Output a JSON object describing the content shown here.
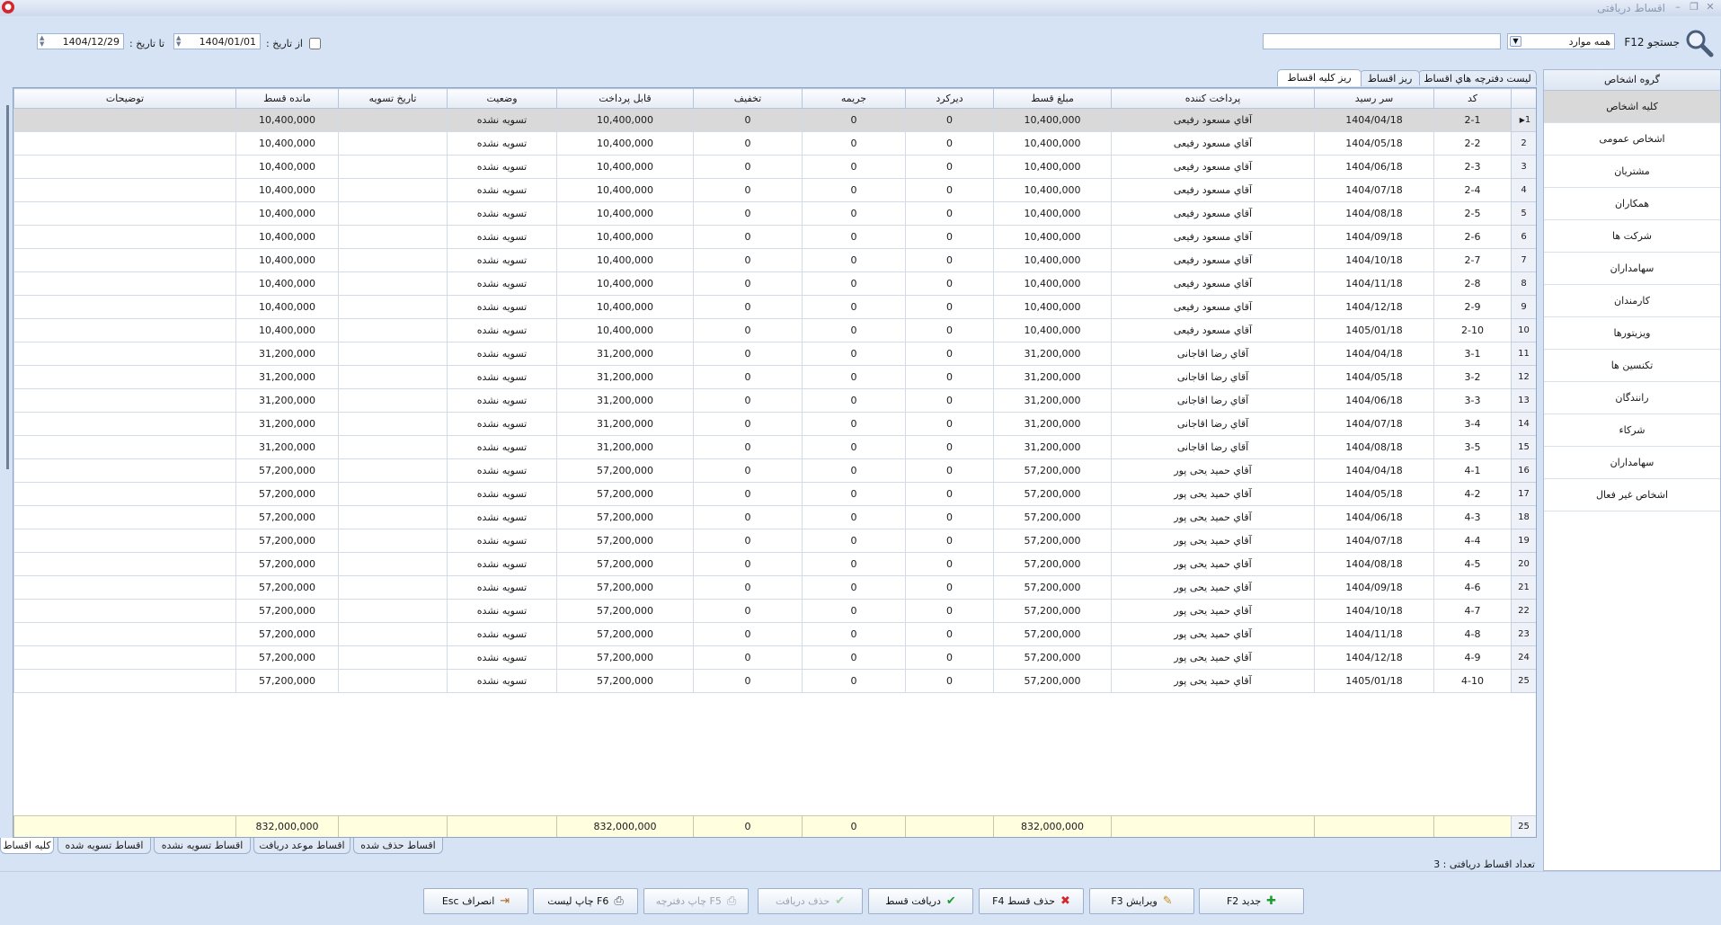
{
  "window": {
    "title": "اقساط دریافتی"
  },
  "search": {
    "label": "جستجو F12",
    "scope_value": "همه موارد",
    "query": ""
  },
  "date_filter": {
    "from_label": "از تاریخ :",
    "from_value": "1404/01/01",
    "to_label": "تا تاریخ :",
    "to_value": "1404/12/29",
    "enabled": false
  },
  "tabs": [
    {
      "label": "لیست دفترچه هاي اقساط"
    },
    {
      "label": "ریز اقساط"
    },
    {
      "label": "ریز کلیه اقساط"
    }
  ],
  "grid": {
    "columns": [
      "کد",
      "سر رسید",
      "پرداخت کننده",
      "مبلغ قسط",
      "دیرکرد",
      "جریمه",
      "تخفیف",
      "قابل پرداخت",
      "وضعیت",
      "تاریخ تسویه",
      "مانده قسط",
      "توضیحات"
    ],
    "rows": [
      {
        "n": "1",
        "code": "2-1",
        "due": "1404/04/18",
        "payer": "آقاي مسعود رفیعی",
        "amount": "10,400,000",
        "late": "0",
        "penalty": "0",
        "discount": "0",
        "payable": "10,400,000",
        "status": "تسویه نشده",
        "settle": "",
        "remain": "10,400,000",
        "desc": ""
      },
      {
        "n": "2",
        "code": "2-2",
        "due": "1404/05/18",
        "payer": "آقاي مسعود رفیعی",
        "amount": "10,400,000",
        "late": "0",
        "penalty": "0",
        "discount": "0",
        "payable": "10,400,000",
        "status": "تسویه نشده",
        "settle": "",
        "remain": "10,400,000",
        "desc": ""
      },
      {
        "n": "3",
        "code": "2-3",
        "due": "1404/06/18",
        "payer": "آقاي مسعود رفیعی",
        "amount": "10,400,000",
        "late": "0",
        "penalty": "0",
        "discount": "0",
        "payable": "10,400,000",
        "status": "تسویه نشده",
        "settle": "",
        "remain": "10,400,000",
        "desc": ""
      },
      {
        "n": "4",
        "code": "2-4",
        "due": "1404/07/18",
        "payer": "آقاي مسعود رفیعی",
        "amount": "10,400,000",
        "late": "0",
        "penalty": "0",
        "discount": "0",
        "payable": "10,400,000",
        "status": "تسویه نشده",
        "settle": "",
        "remain": "10,400,000",
        "desc": ""
      },
      {
        "n": "5",
        "code": "2-5",
        "due": "1404/08/18",
        "payer": "آقاي مسعود رفیعی",
        "amount": "10,400,000",
        "late": "0",
        "penalty": "0",
        "discount": "0",
        "payable": "10,400,000",
        "status": "تسویه نشده",
        "settle": "",
        "remain": "10,400,000",
        "desc": ""
      },
      {
        "n": "6",
        "code": "2-6",
        "due": "1404/09/18",
        "payer": "آقاي مسعود رفیعی",
        "amount": "10,400,000",
        "late": "0",
        "penalty": "0",
        "discount": "0",
        "payable": "10,400,000",
        "status": "تسویه نشده",
        "settle": "",
        "remain": "10,400,000",
        "desc": ""
      },
      {
        "n": "7",
        "code": "2-7",
        "due": "1404/10/18",
        "payer": "آقاي مسعود رفیعی",
        "amount": "10,400,000",
        "late": "0",
        "penalty": "0",
        "discount": "0",
        "payable": "10,400,000",
        "status": "تسویه نشده",
        "settle": "",
        "remain": "10,400,000",
        "desc": ""
      },
      {
        "n": "8",
        "code": "2-8",
        "due": "1404/11/18",
        "payer": "آقاي مسعود رفیعی",
        "amount": "10,400,000",
        "late": "0",
        "penalty": "0",
        "discount": "0",
        "payable": "10,400,000",
        "status": "تسویه نشده",
        "settle": "",
        "remain": "10,400,000",
        "desc": ""
      },
      {
        "n": "9",
        "code": "2-9",
        "due": "1404/12/18",
        "payer": "آقاي مسعود رفیعی",
        "amount": "10,400,000",
        "late": "0",
        "penalty": "0",
        "discount": "0",
        "payable": "10,400,000",
        "status": "تسویه نشده",
        "settle": "",
        "remain": "10,400,000",
        "desc": ""
      },
      {
        "n": "10",
        "code": "2-10",
        "due": "1405/01/18",
        "payer": "آقاي مسعود رفیعی",
        "amount": "10,400,000",
        "late": "0",
        "penalty": "0",
        "discount": "0",
        "payable": "10,400,000",
        "status": "تسویه نشده",
        "settle": "",
        "remain": "10,400,000",
        "desc": ""
      },
      {
        "n": "11",
        "code": "3-1",
        "due": "1404/04/18",
        "payer": "آقاي رضا اقاجانی",
        "amount": "31,200,000",
        "late": "0",
        "penalty": "0",
        "discount": "0",
        "payable": "31,200,000",
        "status": "تسویه نشده",
        "settle": "",
        "remain": "31,200,000",
        "desc": ""
      },
      {
        "n": "12",
        "code": "3-2",
        "due": "1404/05/18",
        "payer": "آقاي رضا اقاجانی",
        "amount": "31,200,000",
        "late": "0",
        "penalty": "0",
        "discount": "0",
        "payable": "31,200,000",
        "status": "تسویه نشده",
        "settle": "",
        "remain": "31,200,000",
        "desc": ""
      },
      {
        "n": "13",
        "code": "3-3",
        "due": "1404/06/18",
        "payer": "آقاي رضا اقاجانی",
        "amount": "31,200,000",
        "late": "0",
        "penalty": "0",
        "discount": "0",
        "payable": "31,200,000",
        "status": "تسویه نشده",
        "settle": "",
        "remain": "31,200,000",
        "desc": ""
      },
      {
        "n": "14",
        "code": "3-4",
        "due": "1404/07/18",
        "payer": "آقاي رضا اقاجانی",
        "amount": "31,200,000",
        "late": "0",
        "penalty": "0",
        "discount": "0",
        "payable": "31,200,000",
        "status": "تسویه نشده",
        "settle": "",
        "remain": "31,200,000",
        "desc": ""
      },
      {
        "n": "15",
        "code": "3-5",
        "due": "1404/08/18",
        "payer": "آقاي رضا اقاجانی",
        "amount": "31,200,000",
        "late": "0",
        "penalty": "0",
        "discount": "0",
        "payable": "31,200,000",
        "status": "تسویه نشده",
        "settle": "",
        "remain": "31,200,000",
        "desc": ""
      },
      {
        "n": "16",
        "code": "4-1",
        "due": "1404/04/18",
        "payer": "آقاي حمید یحی پور",
        "amount": "57,200,000",
        "late": "0",
        "penalty": "0",
        "discount": "0",
        "payable": "57,200,000",
        "status": "تسویه نشده",
        "settle": "",
        "remain": "57,200,000",
        "desc": ""
      },
      {
        "n": "17",
        "code": "4-2",
        "due": "1404/05/18",
        "payer": "آقاي حمید یحی پور",
        "amount": "57,200,000",
        "late": "0",
        "penalty": "0",
        "discount": "0",
        "payable": "57,200,000",
        "status": "تسویه نشده",
        "settle": "",
        "remain": "57,200,000",
        "desc": ""
      },
      {
        "n": "18",
        "code": "4-3",
        "due": "1404/06/18",
        "payer": "آقاي حمید یحی پور",
        "amount": "57,200,000",
        "late": "0",
        "penalty": "0",
        "discount": "0",
        "payable": "57,200,000",
        "status": "تسویه نشده",
        "settle": "",
        "remain": "57,200,000",
        "desc": ""
      },
      {
        "n": "19",
        "code": "4-4",
        "due": "1404/07/18",
        "payer": "آقاي حمید یحی پور",
        "amount": "57,200,000",
        "late": "0",
        "penalty": "0",
        "discount": "0",
        "payable": "57,200,000",
        "status": "تسویه نشده",
        "settle": "",
        "remain": "57,200,000",
        "desc": ""
      },
      {
        "n": "20",
        "code": "4-5",
        "due": "1404/08/18",
        "payer": "آقاي حمید یحی پور",
        "amount": "57,200,000",
        "late": "0",
        "penalty": "0",
        "discount": "0",
        "payable": "57,200,000",
        "status": "تسویه نشده",
        "settle": "",
        "remain": "57,200,000",
        "desc": ""
      },
      {
        "n": "21",
        "code": "4-6",
        "due": "1404/09/18",
        "payer": "آقاي حمید یحی پور",
        "amount": "57,200,000",
        "late": "0",
        "penalty": "0",
        "discount": "0",
        "payable": "57,200,000",
        "status": "تسویه نشده",
        "settle": "",
        "remain": "57,200,000",
        "desc": ""
      },
      {
        "n": "22",
        "code": "4-7",
        "due": "1404/10/18",
        "payer": "آقاي حمید یحی پور",
        "amount": "57,200,000",
        "late": "0",
        "penalty": "0",
        "discount": "0",
        "payable": "57,200,000",
        "status": "تسویه نشده",
        "settle": "",
        "remain": "57,200,000",
        "desc": ""
      },
      {
        "n": "23",
        "code": "4-8",
        "due": "1404/11/18",
        "payer": "آقاي حمید یحی پور",
        "amount": "57,200,000",
        "late": "0",
        "penalty": "0",
        "discount": "0",
        "payable": "57,200,000",
        "status": "تسویه نشده",
        "settle": "",
        "remain": "57,200,000",
        "desc": ""
      },
      {
        "n": "24",
        "code": "4-9",
        "due": "1404/12/18",
        "payer": "آقاي حمید یحی پور",
        "amount": "57,200,000",
        "late": "0",
        "penalty": "0",
        "discount": "0",
        "payable": "57,200,000",
        "status": "تسویه نشده",
        "settle": "",
        "remain": "57,200,000",
        "desc": ""
      },
      {
        "n": "25",
        "code": "4-10",
        "due": "1405/01/18",
        "payer": "آقاي حمید یحی پور",
        "amount": "57,200,000",
        "late": "0",
        "penalty": "0",
        "discount": "0",
        "payable": "57,200,000",
        "status": "تسویه نشده",
        "settle": "",
        "remain": "57,200,000",
        "desc": ""
      }
    ],
    "footer": {
      "count": "25",
      "amount": "832,000,000",
      "penalty": "0",
      "discount": "0",
      "payable": "832,000,000",
      "remain": "832,000,000"
    }
  },
  "bottom_tabs": [
    {
      "label": "کلیه اقساط"
    },
    {
      "label": "اقساط تسویه شده"
    },
    {
      "label": "اقساط تسویه نشده"
    },
    {
      "label": "اقساط موعد دریافت"
    },
    {
      "label": "اقساط حذف شده"
    }
  ],
  "status": {
    "text": "تعداد اقساط دریافتی : 3"
  },
  "sidebar": {
    "header": "گروه اشخاص",
    "items": [
      "کلیه اشخاص",
      "اشخاص عمومی",
      "مشتریان",
      "همکاران",
      "شرکت ها",
      "سهامداران",
      "کارمندان",
      "ویزیتورها",
      "تکنسین ها",
      "رانندگان",
      "شرکاء",
      "سهامداران",
      "اشخاص غیر فعال"
    ]
  },
  "actions": {
    "new": "جدید F2",
    "edit": "ویرایش F3",
    "delete_installment": "حذف قسط F4",
    "receive_installment": "دریافت قسط",
    "delete_receipt": "حذف دریافت",
    "print_booklet": "F5 چاپ دفترچه",
    "print_list": "F6 چاپ لیست",
    "cancel": "انصراف Esc"
  },
  "colors": {
    "background": "#d6e3f5",
    "selected_row": "#d9d9d9",
    "footer_row": "#ffffe0",
    "accent_red": "#d4262c"
  },
  "icons": [
    "search-icon",
    "plus-icon",
    "pencil-icon",
    "delete-x-icon",
    "check-icon",
    "printer-icon",
    "exit-icon",
    "dropdown-arrow-icon",
    "row-pointer-icon"
  ]
}
